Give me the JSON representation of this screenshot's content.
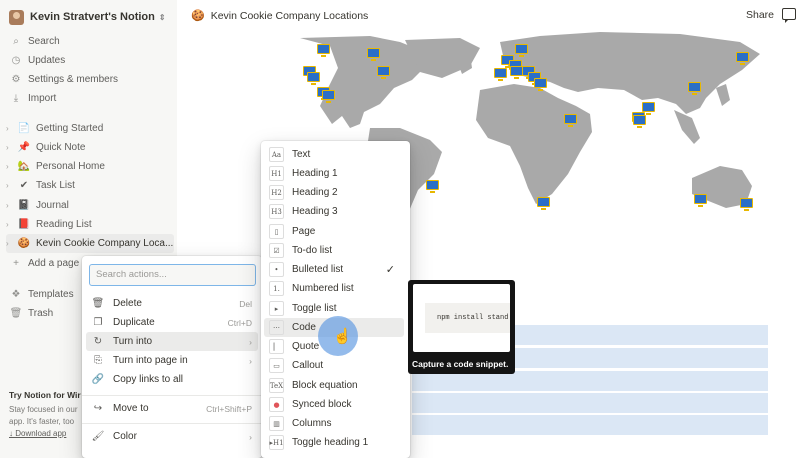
{
  "workspace": {
    "name": "Kevin Stratvert's Notion"
  },
  "nav": [
    {
      "icon": "search-icon",
      "glyph": "⌕",
      "label": "Search"
    },
    {
      "icon": "clock-icon",
      "glyph": "◷",
      "label": "Updates"
    },
    {
      "icon": "gear-icon",
      "glyph": "⚙",
      "label": "Settings & members"
    },
    {
      "icon": "import-icon",
      "glyph": "⤓",
      "label": "Import"
    }
  ],
  "pages": [
    {
      "emoji": "📄",
      "label": "Getting Started"
    },
    {
      "emoji": "📌",
      "label": "Quick Note"
    },
    {
      "emoji": "🏡",
      "label": "Personal Home"
    },
    {
      "emoji": "✔",
      "label": "Task List"
    },
    {
      "emoji": "📓",
      "label": "Journal"
    },
    {
      "emoji": "📕",
      "label": "Reading List"
    },
    {
      "emoji": "🍪",
      "label": "Kevin Cookie Company Loca..."
    }
  ],
  "add_page": "Add a page",
  "bottom_nav": [
    {
      "icon": "templates-icon",
      "glyph": "❖",
      "label": "Templates"
    },
    {
      "icon": "trash-icon",
      "glyph": "🗑",
      "label": "Trash"
    }
  ],
  "promo": {
    "title": "Try Notion for Wir",
    "line1": "Stay focused in our",
    "line2": "app. It's faster, too",
    "download": "↓ Download app"
  },
  "topbar": {
    "emoji": "🍪",
    "title": "Kevin Cookie Company Locations",
    "share": "Share"
  },
  "map_markers": 34,
  "block_menu": {
    "search_placeholder": "Search actions...",
    "items": [
      {
        "icon": "trash-icon",
        "glyph": "🗑",
        "label": "Delete",
        "shortcut": "Del"
      },
      {
        "icon": "duplicate-icon",
        "glyph": "❐",
        "label": "Duplicate",
        "shortcut": "Ctrl+D"
      },
      {
        "icon": "turn-into-icon",
        "glyph": "↻",
        "label": "Turn into",
        "shortcut": "›"
      },
      {
        "icon": "page-icon",
        "glyph": "⎘",
        "label": "Turn into page in",
        "shortcut": "›"
      },
      {
        "icon": "link-icon",
        "glyph": "🔗",
        "label": "Copy links to all",
        "shortcut": ""
      },
      {
        "icon": "move-icon",
        "glyph": "↪",
        "label": "Move to",
        "shortcut": "Ctrl+Shift+P"
      },
      {
        "icon": "color-icon",
        "glyph": "🖌",
        "label": "Color",
        "shortcut": "›"
      }
    ]
  },
  "turn_into_menu": {
    "items": [
      {
        "glyph": "Aa",
        "label": "Text"
      },
      {
        "glyph": "H1",
        "label": "Heading 1"
      },
      {
        "glyph": "H2",
        "label": "Heading 2"
      },
      {
        "glyph": "H3",
        "label": "Heading 3"
      },
      {
        "glyph": "▯",
        "label": "Page"
      },
      {
        "glyph": "☑",
        "label": "To-do list"
      },
      {
        "glyph": "•",
        "label": "Bulleted list",
        "checked": "✓"
      },
      {
        "glyph": "1.",
        "label": "Numbered list"
      },
      {
        "glyph": "▸",
        "label": "Toggle list"
      },
      {
        "glyph": "⋯",
        "label": "Code"
      },
      {
        "glyph": "▏",
        "label": "Quote"
      },
      {
        "glyph": "▭",
        "label": "Callout"
      },
      {
        "glyph": "TeX",
        "label": "Block equation"
      },
      {
        "glyph": "●",
        "label": "Synced block"
      },
      {
        "glyph": "▥",
        "label": "Columns"
      },
      {
        "glyph": "▸H1",
        "label": "Toggle heading 1"
      }
    ]
  },
  "tooltip": {
    "code_text": "npm install stand",
    "caption": "Capture a code snippet."
  },
  "colors": {
    "sidebar": "#f7f7f5",
    "land": "#a9a9a9",
    "marker": "#2b6fc7",
    "marker_border": "#e8b800",
    "table_row": "#dbe7f5",
    "accent": "#7eb6e8"
  }
}
